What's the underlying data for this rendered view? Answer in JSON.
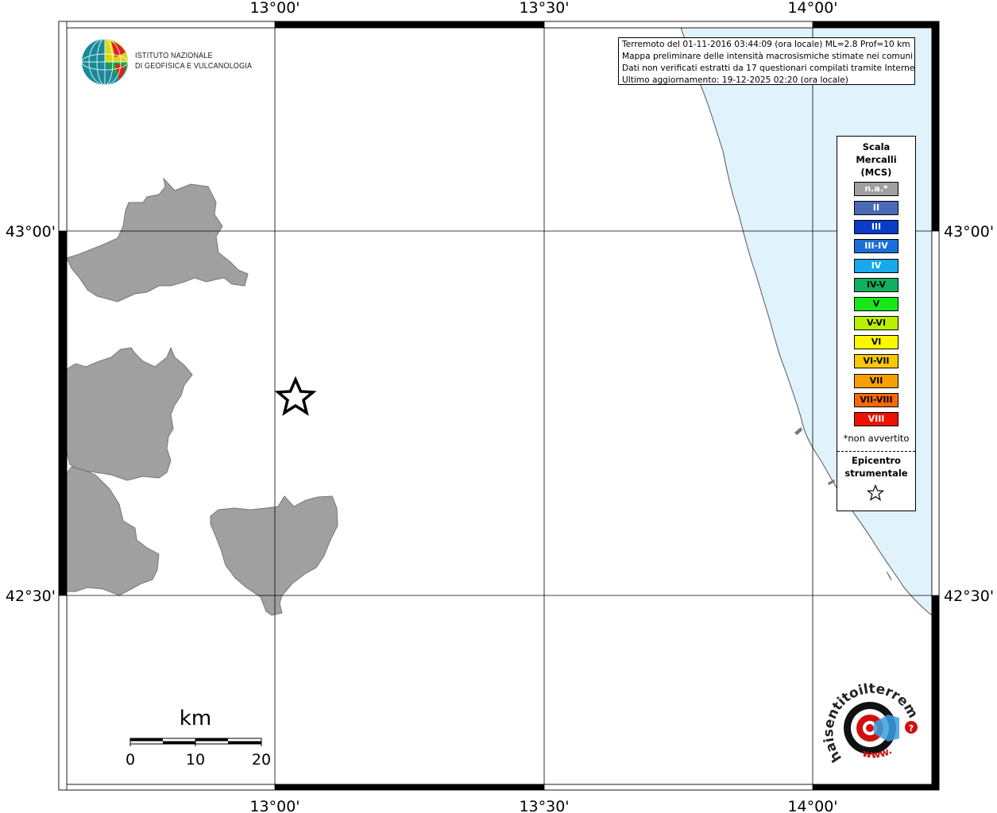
{
  "logo": {
    "line1": "ISTITUTO NAZIONALE",
    "line2": "DI GEOFISICA E VULCANOLOGIA"
  },
  "info": {
    "line1": "Terremoto del 01-11-2016 03:44:09 (ora locale) ML=2.8 Prof=10 km",
    "line2": "Mappa preliminare delle intensità macrosismiche stimate nei comuni",
    "line3": "Dati non verificati estratti da 17 questionari compilati tramite Internet.",
    "line4": "Ultimo aggiornamento: 19-12-2025 02:20 (ora locale)"
  },
  "axes": {
    "lon_labels": [
      "13°00'",
      "13°30'",
      "14°00'"
    ],
    "lat_labels": [
      "43°00'",
      "42°30'"
    ]
  },
  "scalebar": {
    "unit": "km",
    "ticks": [
      "0",
      "10",
      "20"
    ]
  },
  "legend": {
    "title_lines": [
      "Scala",
      "Mercalli",
      "(MCS)"
    ],
    "items": [
      {
        "label": "n.a.*",
        "color": "#a0a0a0",
        "text_color": "#ffffff"
      },
      {
        "label": "II",
        "color": "#4a6ab8",
        "text_color": "#ffffff"
      },
      {
        "label": "III",
        "color": "#0a3cc8",
        "text_color": "#ffffff"
      },
      {
        "label": "III-IV",
        "color": "#1a6ed8",
        "text_color": "#ffffff"
      },
      {
        "label": "IV",
        "color": "#18a8ec",
        "text_color": "#ffffff"
      },
      {
        "label": "IV-V",
        "color": "#10b060",
        "text_color": "#000000"
      },
      {
        "label": "V",
        "color": "#18e818",
        "text_color": "#000000"
      },
      {
        "label": "V-VI",
        "color": "#b8f000",
        "text_color": "#000000"
      },
      {
        "label": "VI",
        "color": "#f8f800",
        "text_color": "#000000"
      },
      {
        "label": "VI-VII",
        "color": "#f8c800",
        "text_color": "#000000"
      },
      {
        "label": "VII",
        "color": "#f8a000",
        "text_color": "#000000"
      },
      {
        "label": "VII-VIII",
        "color": "#f86800",
        "text_color": "#000000"
      },
      {
        "label": "VIII",
        "color": "#f01000",
        "text_color": "#ffffff"
      }
    ],
    "note": "*non avvertito",
    "epicenter_lines": [
      "Epicentro",
      "strumentale"
    ]
  },
  "stamp": {
    "text": "haisentitoilterremoto.it",
    "url_text": "www."
  },
  "colors": {
    "sea": "#e0f2fc",
    "municipality": "#a0a0a0"
  }
}
